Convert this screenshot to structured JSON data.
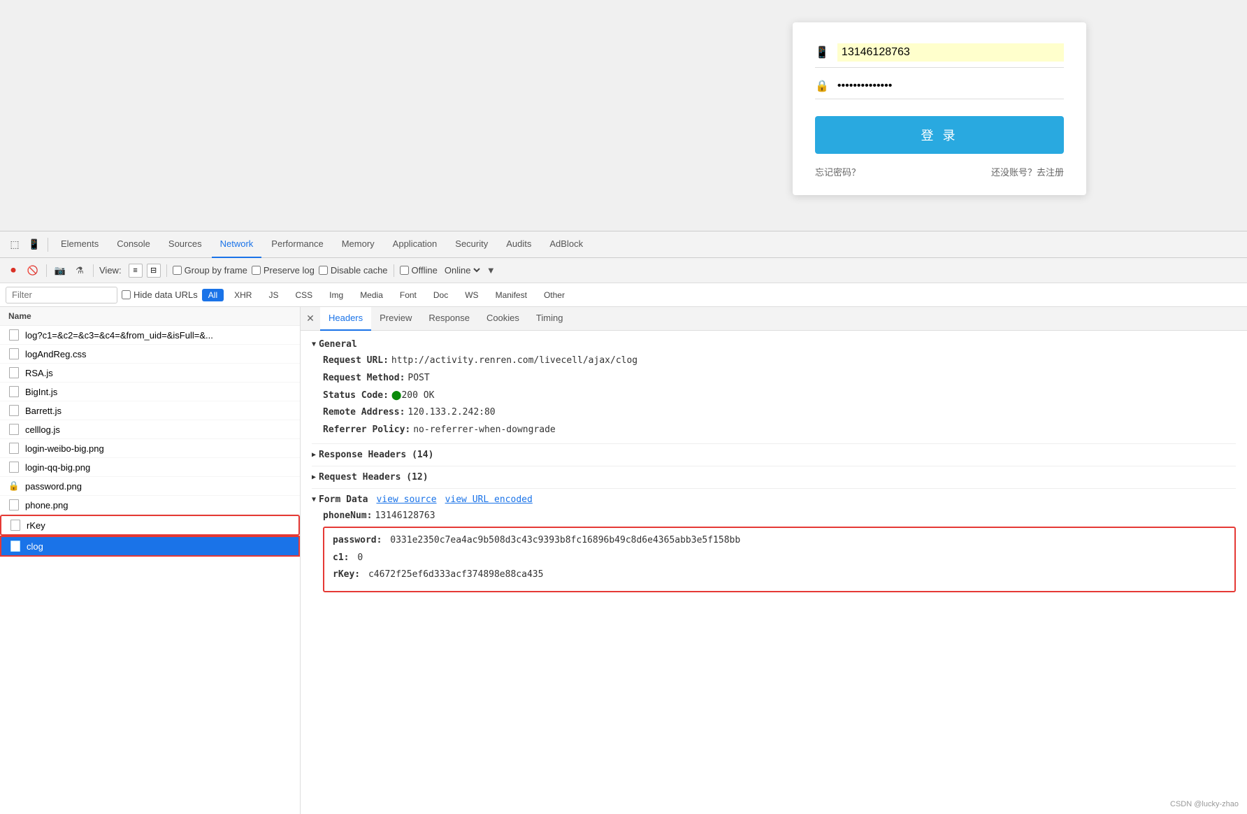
{
  "page": {
    "phone_number": "13146128763",
    "password_dots": "••••••••••••••",
    "login_btn": "登 录",
    "forgot_password": "忘记密码？",
    "register_link": "还没账号？去注册"
  },
  "devtools": {
    "tabs": [
      "Elements",
      "Console",
      "Sources",
      "Network",
      "Performance",
      "Memory",
      "Application",
      "Security",
      "Audits",
      "AdBlock"
    ],
    "active_tab": "Network"
  },
  "toolbar": {
    "view_label": "View:",
    "group_by_frame": "Group by frame",
    "preserve_log": "Preserve log",
    "disable_cache": "Disable cache",
    "offline": "Offline",
    "online": "Online"
  },
  "filter": {
    "placeholder": "Filter",
    "hide_data_urls": "Hide data URLs",
    "tags": [
      "All",
      "XHR",
      "JS",
      "CSS",
      "Img",
      "Media",
      "Font",
      "Doc",
      "WS",
      "Manifest",
      "Other"
    ]
  },
  "file_list": {
    "header": "Name",
    "files": [
      {
        "name": "log?c1=&c2=&c3=&c4=&from_uid=&isFull=&...",
        "type": "doc",
        "highlighted": false
      },
      {
        "name": "logAndReg.css",
        "type": "doc",
        "highlighted": false
      },
      {
        "name": "RSA.js",
        "type": "doc",
        "highlighted": false
      },
      {
        "name": "BigInt.js",
        "type": "doc",
        "highlighted": false
      },
      {
        "name": "Barrett.js",
        "type": "doc",
        "highlighted": false
      },
      {
        "name": "celllog.js",
        "type": "doc",
        "highlighted": false
      },
      {
        "name": "login-weibo-big.png",
        "type": "doc",
        "highlighted": false
      },
      {
        "name": "login-qq-big.png",
        "type": "doc",
        "highlighted": false
      },
      {
        "name": "password.png",
        "type": "lock",
        "highlighted": false
      },
      {
        "name": "phone.png",
        "type": "doc",
        "highlighted": false
      },
      {
        "name": "rKey",
        "type": "doc",
        "highlighted": true
      },
      {
        "name": "clog",
        "type": "doc",
        "highlighted": false,
        "active": true
      }
    ]
  },
  "request_tabs": [
    "Headers",
    "Preview",
    "Response",
    "Cookies",
    "Timing"
  ],
  "request_detail": {
    "general": {
      "title": "General",
      "request_url_label": "Request URL:",
      "request_url_val": "http://activity.renren.com/livecell/ajax/clog",
      "method_label": "Request Method:",
      "method_val": "POST",
      "status_label": "Status Code:",
      "status_val": "200  OK",
      "remote_label": "Remote Address:",
      "remote_val": "120.133.2.242:80",
      "referrer_label": "Referrer Policy:",
      "referrer_val": "no-referrer-when-downgrade"
    },
    "response_headers": "Response Headers (14)",
    "request_headers": "Request Headers (12)",
    "form_data": {
      "title": "Form Data",
      "view_source": "view source",
      "view_encoded": "view URL encoded",
      "phone_label": "phoneNum:",
      "phone_val": "13146128763",
      "password_label": "password:",
      "password_val": "0331e2350c7ea4ac9b508d3c43c9393b8fc16896b49c8d6e4365abb3e5f158bb",
      "c1_label": "c1:",
      "c1_val": "0",
      "rkey_label": "rKey:",
      "rkey_val": "c4672f25ef6d333acf374898e88ca435"
    }
  },
  "watermark": "CSDN @lucky-zhao"
}
